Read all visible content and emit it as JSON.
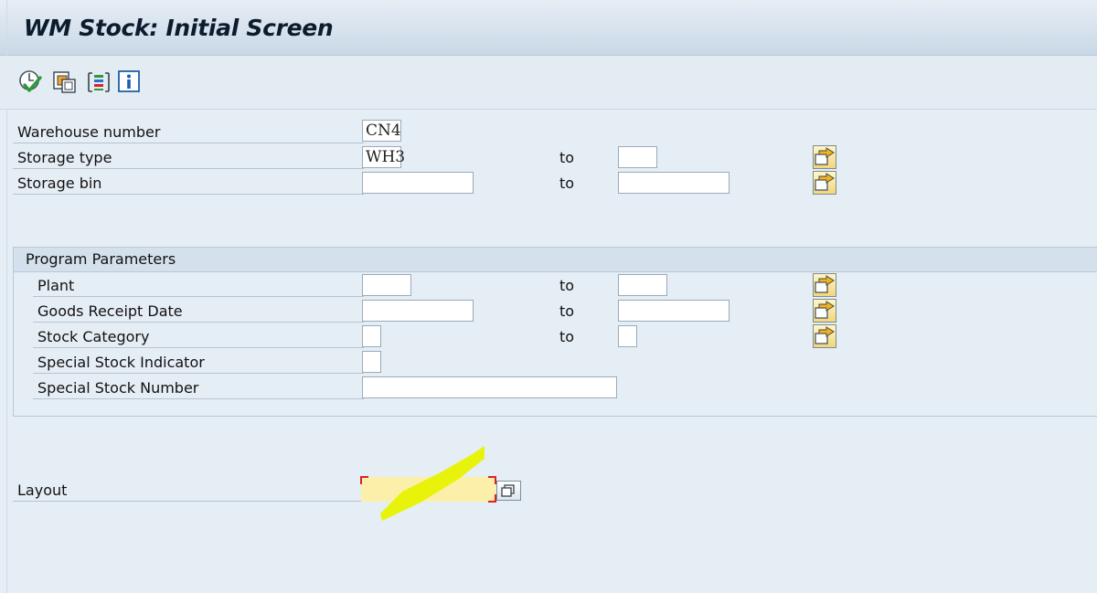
{
  "window": {
    "title": "WM Stock: Initial Screen"
  },
  "toolbar": {
    "buttons": [
      {
        "icon": "execute-icon"
      },
      {
        "icon": "get-variant-icon"
      },
      {
        "icon": "selection-options-icon"
      },
      {
        "icon": "info-icon"
      }
    ]
  },
  "selection": {
    "warehouse_number": {
      "label": "Warehouse number",
      "value": "CN4"
    },
    "storage_type": {
      "label": "Storage type",
      "from": "WH3",
      "to_label": "to",
      "to": ""
    },
    "storage_bin": {
      "label": "Storage bin",
      "from": "",
      "to_label": "to",
      "to": ""
    }
  },
  "program_parameters": {
    "title": "Program Parameters",
    "plant": {
      "label": "Plant",
      "from": "",
      "to_label": "to",
      "to": ""
    },
    "goods_receipt_date": {
      "label": "Goods Receipt Date",
      "from": "",
      "to_label": "to",
      "to": ""
    },
    "stock_category": {
      "label": "Stock Category",
      "from": "",
      "to_label": "to",
      "to": ""
    },
    "special_stock_indicator": {
      "label": "Special Stock Indicator",
      "value": ""
    },
    "special_stock_number": {
      "label": "Special Stock Number",
      "value": ""
    }
  },
  "layout": {
    "label": "Layout",
    "value": ""
  },
  "colors": {
    "highlight_marker": "#e8f200",
    "required_field_bg": "#fcefa9",
    "required_corner": "#d8232a"
  }
}
